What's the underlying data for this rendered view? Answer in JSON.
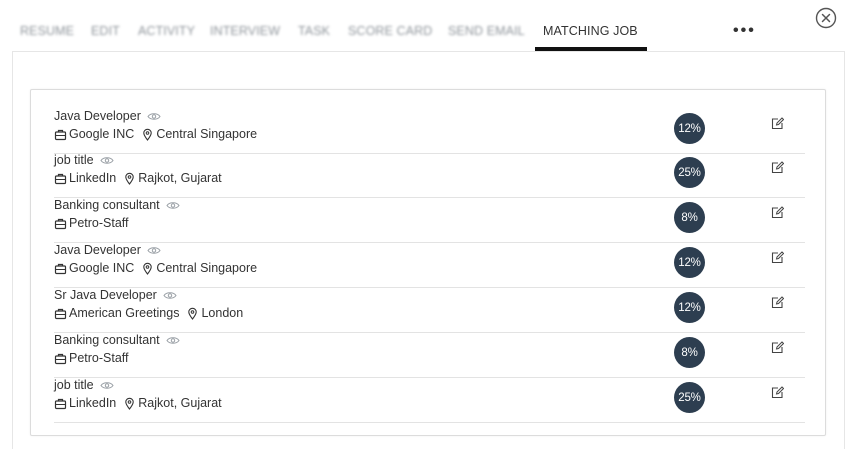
{
  "tabs": [
    {
      "label": "RESUME",
      "active": false
    },
    {
      "label": "EDIT",
      "active": false
    },
    {
      "label": "ACTIVITY",
      "active": false
    },
    {
      "label": "INTERVIEW",
      "active": false
    },
    {
      "label": "TASK",
      "active": false
    },
    {
      "label": "SCORE CARD",
      "active": false
    },
    {
      "label": "SEND EMAIL",
      "active": false
    },
    {
      "label": "MATCHING JOB",
      "active": true
    }
  ],
  "more_label": "•••",
  "icons": {
    "close": "close-circle-icon",
    "eye": "eye-icon",
    "company": "briefcase-icon",
    "location": "map-pin-icon",
    "edit": "edit-icon"
  },
  "colors": {
    "badge": "#2d3e50",
    "active_tab_underline": "#111111",
    "text": "#333333"
  },
  "jobs": [
    {
      "title": "Java Developer",
      "company": "Google INC",
      "location": "Central Singapore",
      "match": "12%"
    },
    {
      "title": "job title",
      "company": "LinkedIn",
      "location": "Rajkot, Gujarat",
      "match": "25%"
    },
    {
      "title": "Banking consultant",
      "company": "Petro-Staff",
      "location": "",
      "match": "8%"
    },
    {
      "title": "Java Developer",
      "company": "Google INC",
      "location": "Central Singapore",
      "match": "12%"
    },
    {
      "title": "Sr Java Developer",
      "company": "American Greetings",
      "location": "London",
      "match": "12%"
    },
    {
      "title": "Banking consultant",
      "company": "Petro-Staff",
      "location": "",
      "match": "8%"
    },
    {
      "title": "job title",
      "company": "LinkedIn",
      "location": "Rajkot, Gujarat",
      "match": "25%"
    }
  ]
}
